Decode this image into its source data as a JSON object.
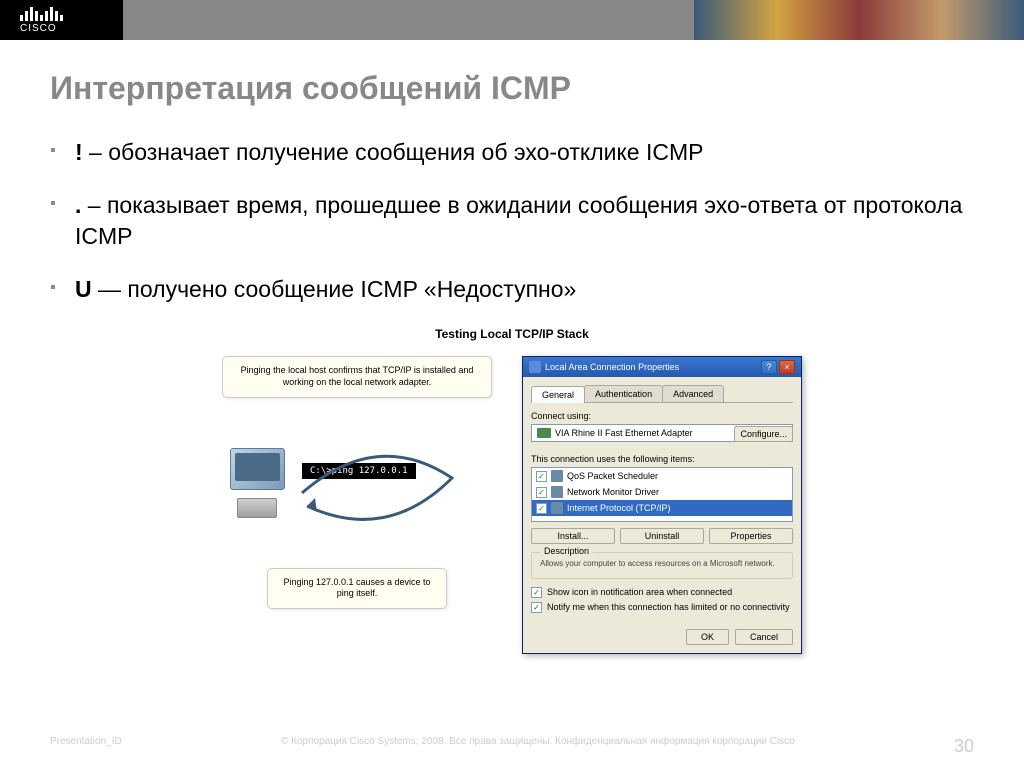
{
  "logo_text": "CISCO",
  "slide_title": "Интерпретация сообщений ICMP",
  "bullets": [
    {
      "marker": "!",
      "text": " – обозначает получение сообщения об эхо-отклике ICMP"
    },
    {
      "marker": ".",
      "text": " – показывает время, прошедшее в ожидании сообщения эхо-ответа от протокола ICMP"
    },
    {
      "marker": "U",
      "text": " — получено сообщение ICMP «Недоступно»"
    }
  ],
  "diagram": {
    "title": "Testing Local TCP/IP Stack",
    "callout_top": "Pinging the local host confirms that TCP/IP is installed and working on the local network adapter.",
    "ping_cmd": "C:\\>ping 127.0.0.1",
    "callout_bottom": "Pinging 127.0.0.1 causes a device to ping itself."
  },
  "dialog": {
    "title": "Local Area Connection Properties",
    "tabs": {
      "active": "General",
      "t2": "Authentication",
      "t3": "Advanced"
    },
    "connect_label": "Connect using:",
    "adapter": "VIA Rhine II Fast Ethernet Adapter",
    "configure_btn": "Configure...",
    "items_label": "This connection uses the following items:",
    "items": [
      "QoS Packet Scheduler",
      "Network Monitor Driver",
      "Internet Protocol (TCP/IP)"
    ],
    "btn_install": "Install...",
    "btn_uninstall": "Uninstall",
    "btn_properties": "Properties",
    "desc_title": "Description",
    "desc_text": "Allows your computer to access resources on a Microsoft network.",
    "check1": "Show icon in notification area when connected",
    "check2": "Notify me when this connection has limited or no connectivity",
    "btn_ok": "OK",
    "btn_cancel": "Cancel"
  },
  "footer": {
    "left": "Presentation_ID",
    "center": "© Корпорация Cisco Systems, 2008. Все права защищены. Конфиденциальная информация корпорации Cisco",
    "slide_num": "30"
  }
}
